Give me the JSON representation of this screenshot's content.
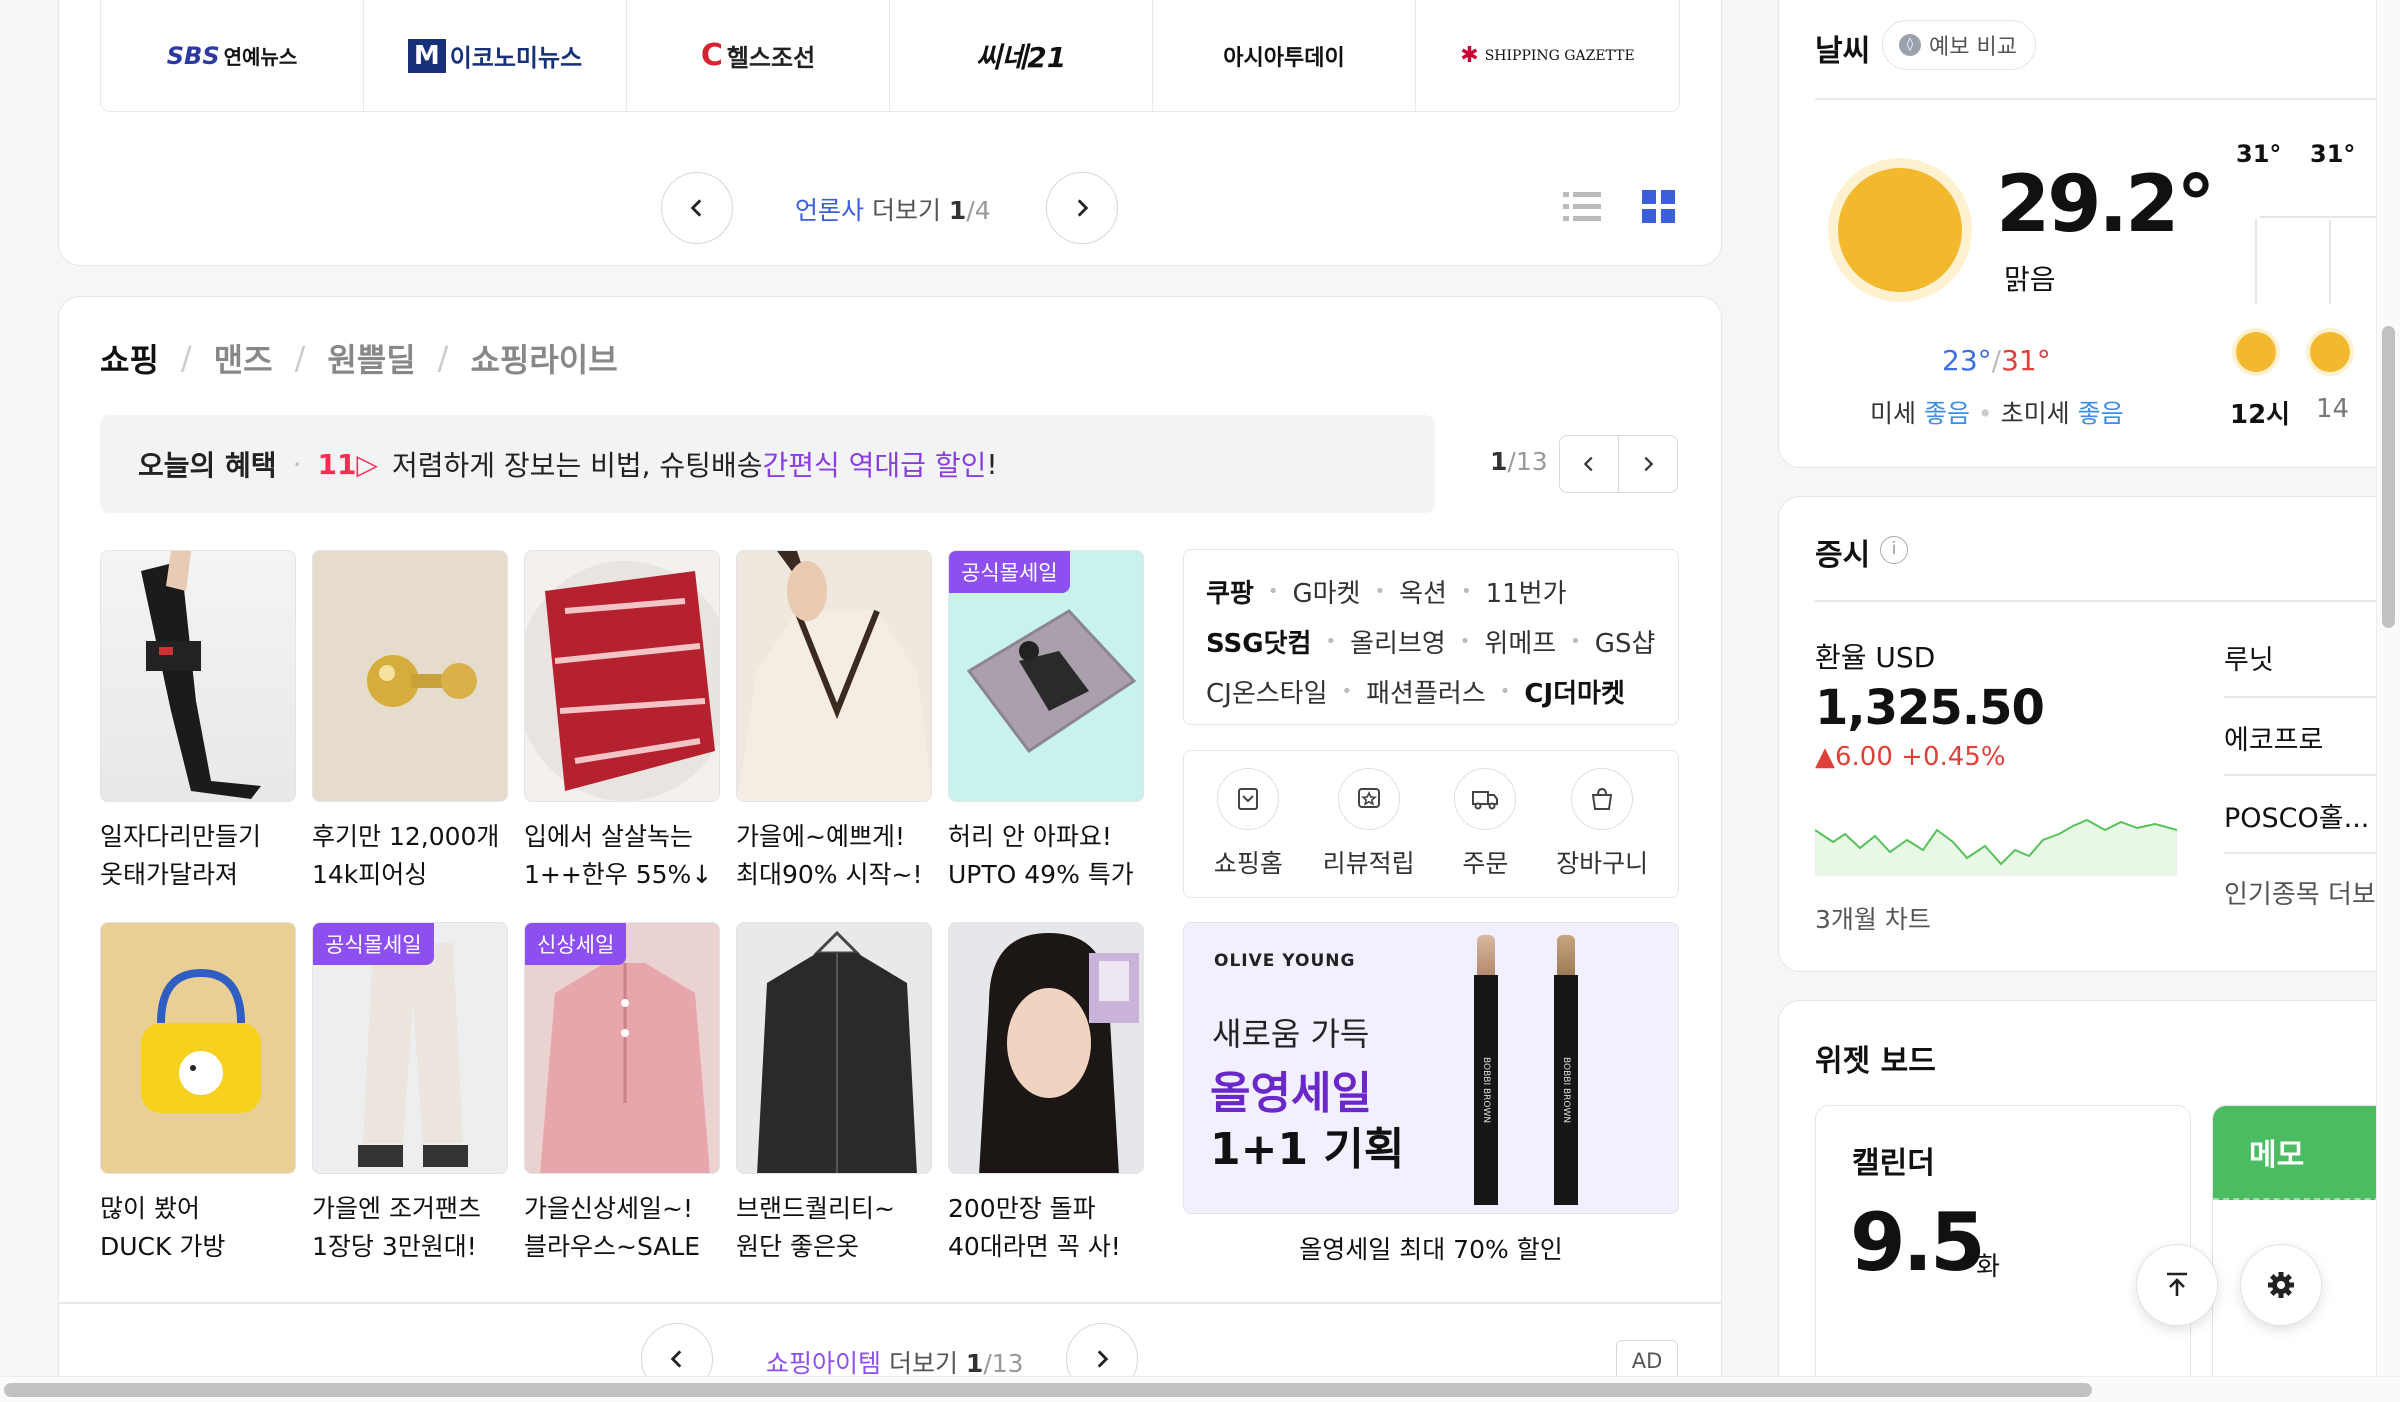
{
  "press": {
    "logos": [
      "SBS 연예뉴스",
      "이코노미뉴스",
      "헬스조선",
      "씨네21",
      "아시아투데이",
      "SHIPPING GAZETTE"
    ],
    "pager_highlight": "언론사",
    "pager_label": " 더보기 ",
    "pager_current": "1",
    "pager_total": "/4"
  },
  "shopping": {
    "tabs": [
      "쇼핑",
      "맨즈",
      "원쁠딜",
      "쇼핑라이브"
    ],
    "benefit": {
      "title": "오늘의 혜택",
      "logo": "11",
      "text": "저렴하게 장보는 비법, 슈팅배송 ",
      "highlight": "간편식 역대급 할인",
      "end": "!"
    },
    "page_current": "1",
    "page_total": "/13",
    "products": [
      {
        "caption1": "일자다리만들기",
        "caption2": "옷태가달라져",
        "badge": ""
      },
      {
        "caption1": "후기만 12,000개",
        "caption2": "14k피어싱",
        "badge": ""
      },
      {
        "caption1": "입에서 살살녹는",
        "caption2": "1++한우 55%↓",
        "badge": ""
      },
      {
        "caption1": "가을에~예쁘게!",
        "caption2": "최대90% 시작~!",
        "badge": ""
      },
      {
        "caption1": "허리 안 아파요!",
        "caption2": "UPTO 49% 특가",
        "badge": "공식몰세일"
      },
      {
        "caption1": "많이 봤어",
        "caption2": "DUCK 가방",
        "badge": ""
      },
      {
        "caption1": "가을엔 조거팬츠",
        "caption2": "1장당 3만원대!",
        "badge": "공식몰세일"
      },
      {
        "caption1": "가을신상세일~!",
        "caption2": "블라우스~SALE",
        "badge": "신상세일"
      },
      {
        "caption1": "브랜드퀄리티~",
        "caption2": "원단 좋은옷",
        "badge": ""
      },
      {
        "caption1": "200만장 돌파",
        "caption2": "40대라면 꼭 사!",
        "badge": ""
      }
    ],
    "malls": [
      [
        "쿠팡",
        "G마켓",
        "옥션",
        "11번가"
      ],
      [
        "SSG닷컴",
        "올리브영",
        "위메프",
        "GS샵"
      ],
      [
        "CJ온스타일",
        "패션플러스",
        "CJ더마켓"
      ]
    ],
    "quick_menu": [
      "쇼핑홈",
      "리뷰적립",
      "주문",
      "장바구니"
    ],
    "ad": {
      "brand": "OLIVE YOUNG",
      "line1": "새로움 가득",
      "line2": "올영세일",
      "line3": "1+1 기획",
      "product_text": "BOBBI BROWN",
      "caption": "올영세일 최대 70% 할인"
    },
    "more_highlight": "쇼핑아이템",
    "more_label": " 더보기 ",
    "more_current": "1",
    "more_total": "/13",
    "ad_label": "AD"
  },
  "weather": {
    "title": "날씨",
    "compare": "예보 비교",
    "temp": "29.2°",
    "condition": "맑음",
    "low": "23°",
    "slash": "/",
    "high": "31°",
    "dust_label": "미세",
    "dust_value": "좋음",
    "fine_dust_label": "초미세",
    "fine_dust_value": "좋음",
    "hourly": [
      {
        "temp": "31°",
        "time": "12시"
      },
      {
        "temp": "31°",
        "time": "14"
      }
    ]
  },
  "stock": {
    "title": "증시",
    "fx_label": "환율 USD",
    "fx_value": "1,325.50",
    "fx_change": "6.00",
    "fx_pct": "+0.45%",
    "chart_label": "3개월 차트",
    "list": [
      "루닛",
      "에코프로",
      "POSCO홀...",
      "인기종목 더보"
    ]
  },
  "widget": {
    "title": "위젯 보드",
    "calendar_label": "캘린더",
    "date": "9.5",
    "weekday": "화",
    "memo_label": "메모"
  },
  "colors": {
    "accent": "#3a5fd9",
    "purple": "#8d4ff0",
    "red": "#e0403a",
    "memo": "#4cbc62"
  }
}
